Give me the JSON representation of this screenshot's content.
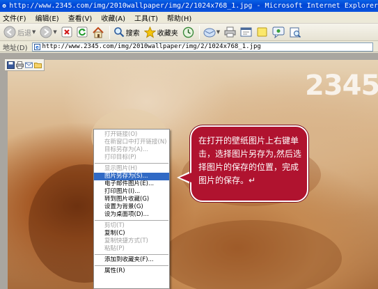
{
  "window": {
    "title": "http://www.2345.com/img/2010wallpaper/img/2/1024x768_1.jpg - Microsoft Internet Explorer"
  },
  "menubar": {
    "items": [
      "文件(F)",
      "编辑(E)",
      "查看(V)",
      "收藏(A)",
      "工具(T)",
      "帮助(H)"
    ]
  },
  "toolbar": {
    "back_label": "后退",
    "search_label": "搜索",
    "favorites_label": "收藏夹",
    "icons": [
      "back-arrow-icon",
      "forward-arrow-icon",
      "stop-icon",
      "refresh-icon",
      "home-icon",
      "search-icon",
      "favorites-star-icon",
      "history-icon",
      "mail-icon",
      "print-icon",
      "edit-icon",
      "discuss-icon",
      "messenger-icon",
      "research-icon"
    ]
  },
  "address": {
    "label": "地址(D)",
    "url": "http://www.2345.com/img/2010wallpaper/img/2/1024x768_1.jpg"
  },
  "content": {
    "brand_logo": "2345",
    "image_toolbar_icons": [
      "save-icon",
      "print-icon",
      "mail-icon",
      "folder-icon"
    ]
  },
  "context_menu": {
    "groups": [
      [
        {
          "label": "打开链接(O)",
          "enabled": false
        },
        {
          "label": "在新窗口中打开链接(N)",
          "enabled": false
        },
        {
          "label": "目标另存为(A)...",
          "enabled": false
        },
        {
          "label": "打印目标(P)",
          "enabled": false
        }
      ],
      [
        {
          "label": "显示图片(H)",
          "enabled": false
        },
        {
          "label": "图片另存为(S)...",
          "enabled": true,
          "highlighted": true
        },
        {
          "label": "电子邮件图片(E)...",
          "enabled": true
        },
        {
          "label": "打印图片(I)...",
          "enabled": true
        },
        {
          "label": "转到图片收藏(G)",
          "enabled": true
        },
        {
          "label": "设置为背景(G)",
          "enabled": true
        },
        {
          "label": "设为桌面项(D)...",
          "enabled": true
        }
      ],
      [
        {
          "label": "剪切(T)",
          "enabled": false
        },
        {
          "label": "复制(C)",
          "enabled": true
        },
        {
          "label": "复制快捷方式(T)",
          "enabled": false
        },
        {
          "label": "粘贴(P)",
          "enabled": false
        }
      ],
      [
        {
          "label": "添加到收藏夹(F)...",
          "enabled": true
        }
      ],
      [
        {
          "label": "属性(R)",
          "enabled": true
        }
      ]
    ]
  },
  "callout": {
    "text": "在打开的壁纸图片上右键单击，选择图片另存为,然后选择图片的保存的位置，完成图片的保存。↵"
  },
  "colors": {
    "titlebar": "#0a53dd",
    "callout": "#b0132f",
    "menu_highlight": "#316ac5"
  }
}
